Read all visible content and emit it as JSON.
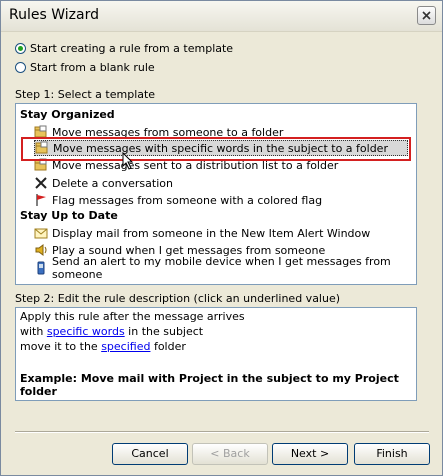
{
  "window": {
    "title": "Rules Wizard"
  },
  "options": [
    {
      "label": "Start creating a rule from a template",
      "checked": true
    },
    {
      "label": "Start from a blank rule",
      "checked": false
    }
  ],
  "step1": {
    "label": "Step 1: Select a template",
    "groups": [
      {
        "header": "Stay Organized",
        "items": [
          {
            "label": "Move messages from someone to a folder",
            "icon": "folder-move-icon"
          },
          {
            "label": "Move messages with specific words in the subject to a folder",
            "icon": "folder-move-icon",
            "selected": true
          },
          {
            "label": "Move messages sent to a distribution list to a folder",
            "icon": "folder-move-icon"
          },
          {
            "label": "Delete a conversation",
            "icon": "delete-x-icon"
          },
          {
            "label": "Flag messages from someone with a colored flag",
            "icon": "red-flag-icon"
          }
        ]
      },
      {
        "header": "Stay Up to Date",
        "items": [
          {
            "label": "Display mail from someone in the New Item Alert Window",
            "icon": "alert-window-icon"
          },
          {
            "label": "Play a sound when I get messages from someone",
            "icon": "sound-icon"
          },
          {
            "label": "Send an alert to my mobile device when I get messages from someone",
            "icon": "mobile-device-icon"
          }
        ]
      }
    ]
  },
  "step2": {
    "label": "Step 2: Edit the rule description (click an underlined value)",
    "line1": "Apply this rule after the message arrives",
    "line2_pre": "with ",
    "line2_link": "specific words",
    "line2_post": " in the subject",
    "line3_pre": "move it to the ",
    "line3_link": "specified",
    "line3_post": " folder",
    "example": "Example: Move mail with Project in the subject to my Project folder"
  },
  "buttons": {
    "cancel": "Cancel",
    "back": "< Back",
    "next": "Next >",
    "finish": "Finish"
  },
  "colors": {
    "highlight_box": "#d42020",
    "link": "#0000ee",
    "radio_dot": "#21a121"
  }
}
